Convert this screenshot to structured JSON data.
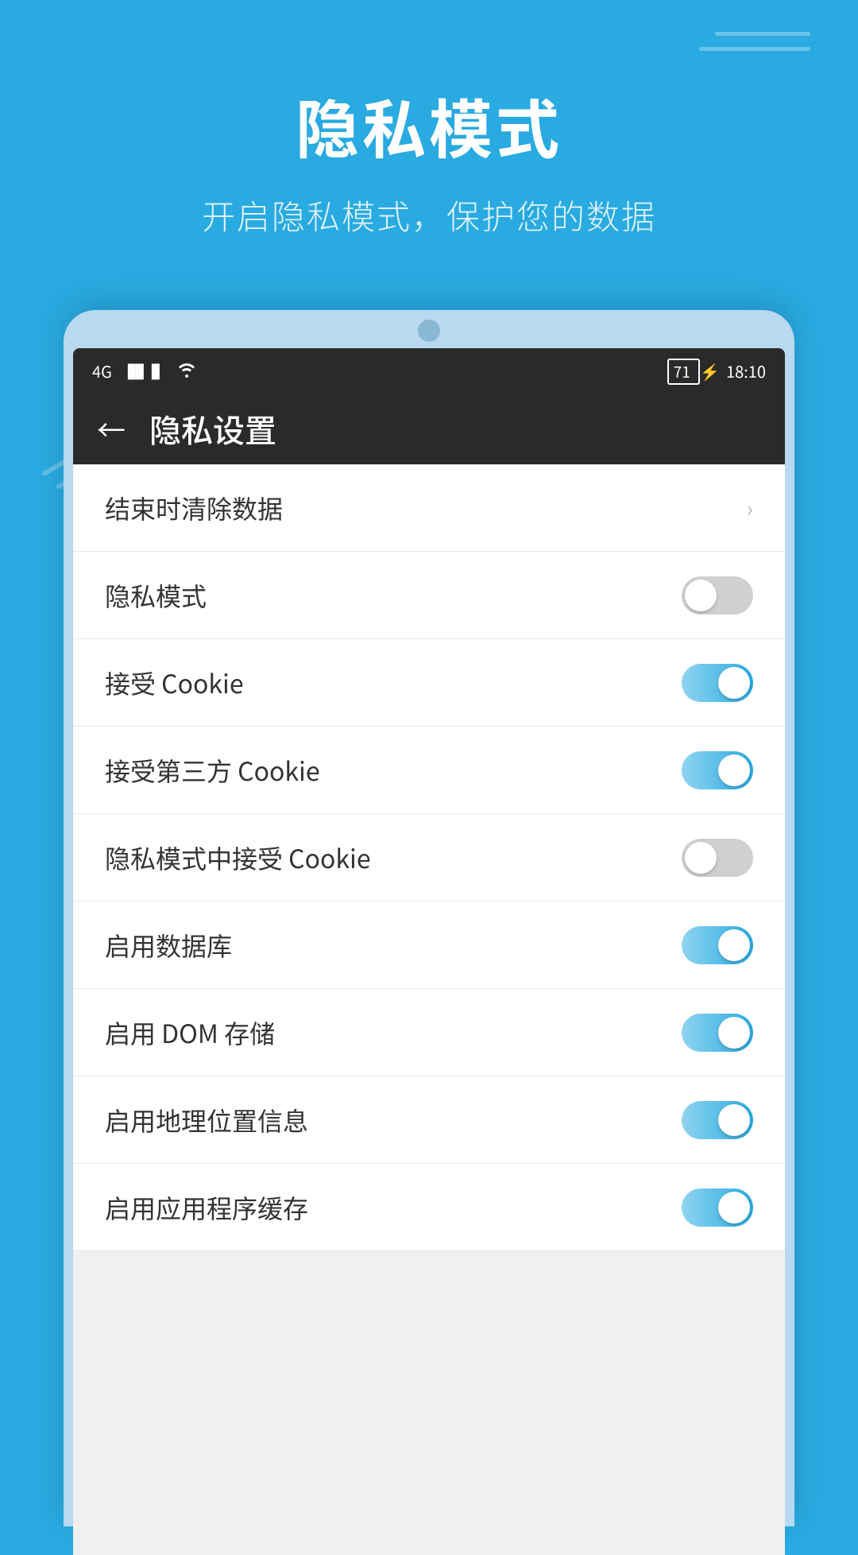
{
  "page": {
    "title": "隐私模式",
    "subtitle": "开启隐私模式，保护您的数据"
  },
  "status_bar": {
    "network": "4G",
    "battery": "71",
    "time": "18:10"
  },
  "nav": {
    "back_icon": "←",
    "title": "隐私设置"
  },
  "settings": [
    {
      "id": "clear-on-exit",
      "label": "结束时清除数据",
      "type": "arrow",
      "has_toggle": false
    },
    {
      "id": "private-mode",
      "label": "隐私模式",
      "type": "toggle",
      "has_toggle": true,
      "enabled": false
    },
    {
      "id": "accept-cookie",
      "label": "接受 Cookie",
      "type": "toggle",
      "has_toggle": true,
      "enabled": true
    },
    {
      "id": "accept-third-party-cookie",
      "label": "接受第三方 Cookie",
      "type": "toggle",
      "has_toggle": true,
      "enabled": true
    },
    {
      "id": "private-mode-cookie",
      "label": "隐私模式中接受 Cookie",
      "type": "toggle",
      "has_toggle": true,
      "enabled": false
    },
    {
      "id": "enable-database",
      "label": "启用数据库",
      "type": "toggle",
      "has_toggle": true,
      "enabled": true
    },
    {
      "id": "enable-dom-storage",
      "label": "启用 DOM 存储",
      "type": "toggle",
      "has_toggle": true,
      "enabled": true
    },
    {
      "id": "enable-geolocation",
      "label": "启用地理位置信息",
      "type": "toggle",
      "has_toggle": true,
      "enabled": true
    },
    {
      "id": "enable-app-cache",
      "label": "启用应用程序缓存",
      "type": "toggle",
      "has_toggle": true,
      "enabled": true
    }
  ],
  "colors": {
    "accent": "#29aae1",
    "toggle_on": "#29aae1",
    "toggle_off": "#d0d0d0",
    "bg": "#29aae1",
    "dark_bar": "#2a2a2a",
    "text_dark": "#333333"
  }
}
